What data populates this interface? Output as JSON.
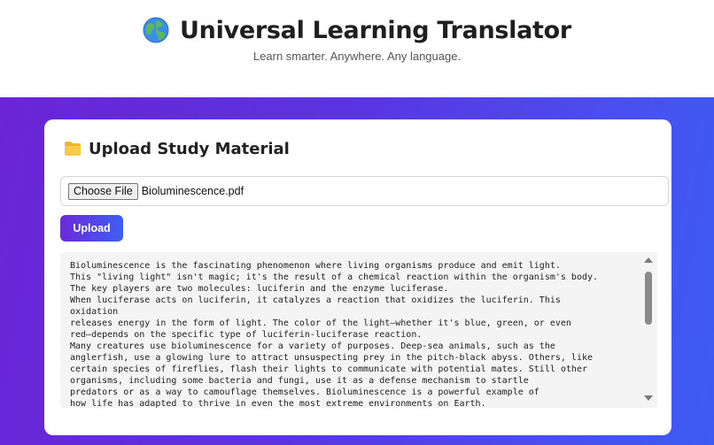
{
  "header": {
    "icon": "globe-icon",
    "title": "Universal Learning Translator",
    "tagline": "Learn smarter. Anywhere. Any language."
  },
  "upload_card": {
    "icon": "folder-icon",
    "title": "Upload Study Material",
    "file_input": {
      "button_label": "Choose File",
      "file_name": "Bioluminescence.pdf"
    },
    "upload_button": "Upload"
  },
  "extracted_text": "Bioluminescence is the fascinating phenomenon where living organisms produce and emit light.\nThis \"living light\" isn't magic; it's the result of a chemical reaction within the organism's body.\nThe key players are two molecules: luciferin and the enzyme luciferase.\nWhen luciferase acts on luciferin, it catalyzes a reaction that oxidizes the luciferin. This\noxidation\nreleases energy in the form of light. The color of the light—whether it's blue, green, or even\nred—depends on the specific type of luciferin-luciferase reaction.\nMany creatures use bioluminescence for a variety of purposes. Deep-sea animals, such as the\nanglerfish, use a glowing lure to attract unsuspecting prey in the pitch-black abyss. Others, like\ncertain species of fireflies, flash their lights to communicate with potential mates. Still other\norganisms, including some bacteria and fungi, use it as a defense mechanism to startle\npredators or as a way to camouflage themselves. Bioluminescence is a powerful example of\nhow life has adapted to thrive in even the most extreme environments on Earth.",
  "colors": {
    "gradient_start": "#6b24d6",
    "gradient_end": "#3b5bf2",
    "card_bg": "#ffffff",
    "text_area_bg": "#f4f4f4"
  }
}
